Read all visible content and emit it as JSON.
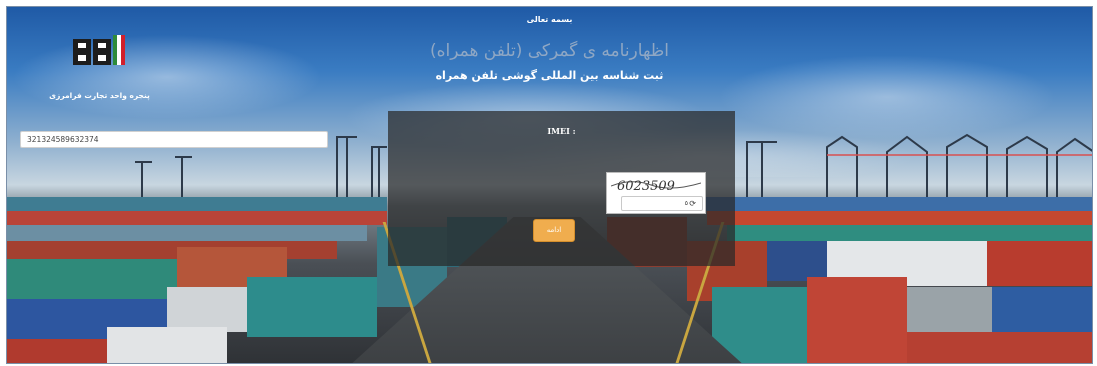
{
  "header": {
    "top_title": "بسمه تعالی",
    "main_title": "اظهارنامه ی گمرکی (تلفن همراه)",
    "sub_title": "ثبت شناسه بین المللی گوشی تلفن همراه"
  },
  "logo": {
    "caption": "پنجره واحد تجارت فرامرزی",
    "colors": {
      "dark": "#1d1d1d",
      "green": "#2e8b3a",
      "red": "#d21f2b"
    }
  },
  "form": {
    "imei_label": "IMEI :",
    "imei_value": "321324589632374",
    "captcha_text": "6023509",
    "captcha_number": "٥",
    "refresh_icon": "refresh-icon",
    "continue_label": "ادامه"
  },
  "colors": {
    "accent_button": "#f0ad4e",
    "panel": "rgba(40,40,40,0.72)"
  }
}
